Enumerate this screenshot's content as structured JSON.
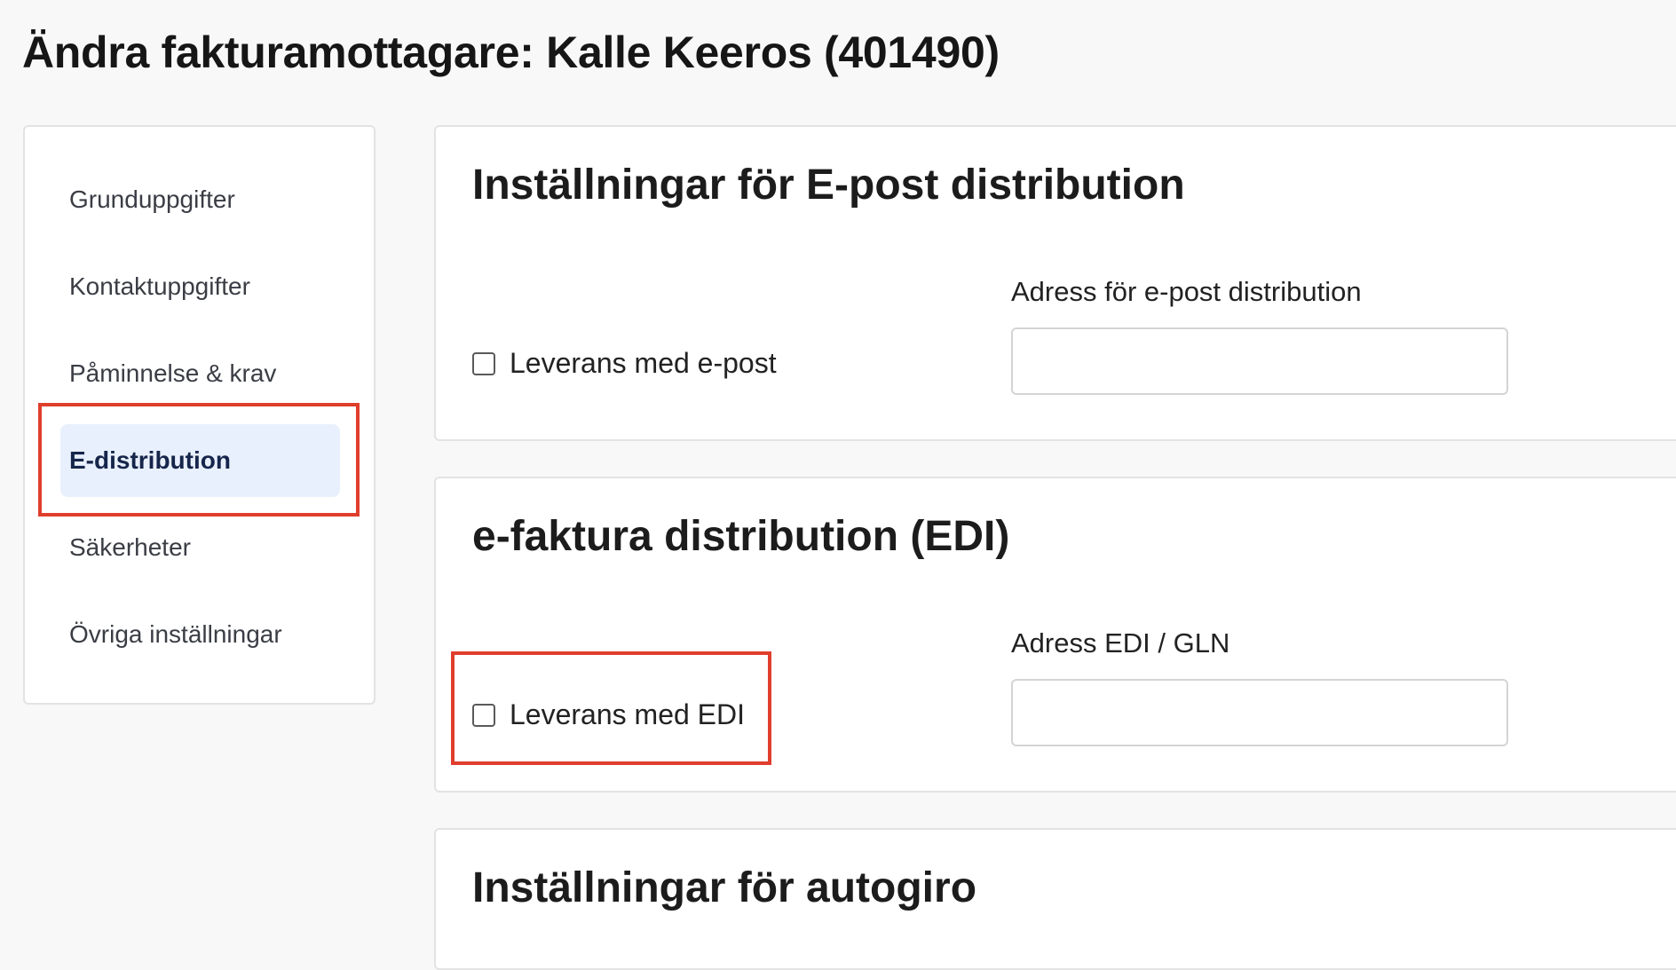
{
  "page": {
    "title": "Ändra fakturamottagare: Kalle Keeros (401490)"
  },
  "sidebar": {
    "items": [
      {
        "label": "Grunduppgifter"
      },
      {
        "label": "Kontaktuppgifter"
      },
      {
        "label": "Påminnelse & krav"
      },
      {
        "label": "E-distribution",
        "active": true
      },
      {
        "label": "Säkerheter"
      },
      {
        "label": "Övriga inställningar"
      }
    ]
  },
  "email_section": {
    "title": "Inställningar för E-post distribution",
    "checkbox_label": "Leverans med e-post",
    "checked": false,
    "field_label": "Adress för e-post distribution",
    "field_value": ""
  },
  "edi_section": {
    "title": "e-faktura distribution (EDI)",
    "checkbox_label": "Leverans med EDI",
    "checked": false,
    "field_label": "Adress EDI / GLN",
    "field_value": ""
  },
  "autogiro_section": {
    "title": "Inställningar för autogiro"
  },
  "colors": {
    "background": "#f8f8f8",
    "active_item_bg": "#e9f0fd",
    "active_item_text": "#16254a",
    "highlight": "#e03e2d"
  }
}
